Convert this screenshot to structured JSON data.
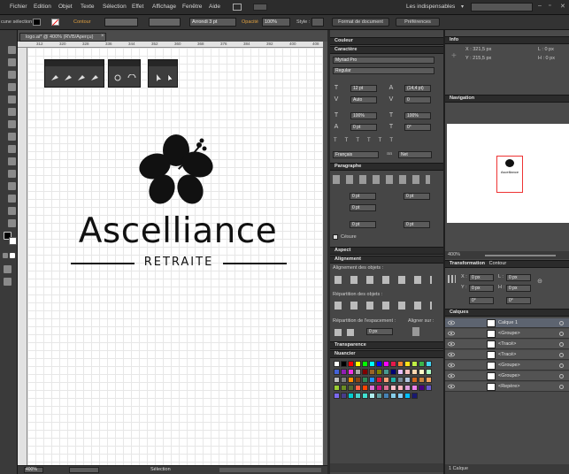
{
  "menu": [
    "Fichier",
    "Edition",
    "Objet",
    "Texte",
    "Sélection",
    "Effet",
    "Affichage",
    "Fenêtre",
    "Aide"
  ],
  "workspace": "Les indispensables",
  "control": {
    "selection_label": "cune sélection",
    "stroke_label": "Contour",
    "brush_value": "Arrondi 3 pt",
    "opacity_label": "Opacité",
    "opacity_value": "100%",
    "style_label": "Style :",
    "doc_format_button": "Format de document",
    "prefs_button": "Préférences"
  },
  "document": {
    "tab_title": "logo.ai* @ 400% (RVB/Aperçu)",
    "ruler_ticks": [
      "312",
      "320",
      "328",
      "336",
      "344",
      "352",
      "360",
      "368",
      "376",
      "384",
      "392",
      "400",
      "408"
    ],
    "zoom": "400%",
    "status": "Sélection"
  },
  "logo": {
    "name": "Ascelliance",
    "subtitle": "RETRAITE",
    "colors": {
      "ink": "#111111"
    }
  },
  "panels": {
    "color_tab": "Couleur",
    "character": {
      "title": "Caractère",
      "font": "Myriad Pro",
      "style": "Regular",
      "size": "12 pt",
      "leading": "(14,4 pt)",
      "kerning": "Auto",
      "tracking": "0",
      "hscale": "100%",
      "vscale": "100%",
      "baseline": "0 pt",
      "rotation": "0°",
      "lang": "Français",
      "aa": "Net"
    },
    "paragraph": {
      "title": "Paragraphe",
      "indent_left": "0 pt",
      "indent_right": "0 pt",
      "indent_first": "0 pt",
      "space_before": "0 pt",
      "space_after": "0 pt",
      "hyphen_label": "Césure"
    },
    "appearance_title": "Aspect",
    "align": {
      "title": "Alignement",
      "objects_label": "Alignement des objets :",
      "distrib_label": "Répartition des objets :",
      "spacing_label": "Répartition de l'espacement :",
      "align_to_label": "Aligner sur :",
      "spacing_value": "0 px"
    },
    "transparency_title": "Transparence",
    "swatches_title": "Nuancier",
    "info": {
      "title": "Info",
      "x": "X : 321,5 px",
      "y": "Y : 215,5 px",
      "w": "L : 0 px",
      "h": "H : 0 px"
    },
    "navigator": {
      "title": "Navigation",
      "zoom": "400%",
      "thumb_name": "Ascelliance"
    },
    "transform": {
      "title": "Transformation",
      "tab2": "Contour",
      "x": "0 px",
      "y": "0 px",
      "w": "0 px",
      "h": "0 px",
      "angle": "0°",
      "shear": "0°"
    },
    "layers": {
      "title": "Calques",
      "rows": [
        "Calque 1",
        "<Groupe>",
        "<Tracé>",
        "<Tracé>",
        "<Groupe>",
        "<Groupe>",
        "<Repère>"
      ],
      "footer": "1 Calque"
    }
  },
  "swatch_colors": [
    "#ffffff",
    "#000000",
    "#ff0000",
    "#ffff00",
    "#00ff00",
    "#00ffff",
    "#0000ff",
    "#ff00ff",
    "#e6194b",
    "#f58231",
    "#ffe119",
    "#bfef45",
    "#3cb44b",
    "#42d4f4",
    "#4363d8",
    "#911eb4",
    "#f032e6",
    "#a9a9a9",
    "#800000",
    "#9a6324",
    "#808000",
    "#469990",
    "#000075",
    "#e6beff",
    "#fabebe",
    "#ffd8b1",
    "#fffac8",
    "#aaffc3",
    "#c0c0c0",
    "#7f7f7f",
    "#ff8c00",
    "#8b4513",
    "#2e8b57",
    "#1e90ff",
    "#dc143c",
    "#ffa07a",
    "#20b2aa",
    "#778899",
    "#b0c4de",
    "#d2691e",
    "#cd853f",
    "#f4a460",
    "#9acd32",
    "#6b8e23",
    "#556b2f",
    "#ff6347",
    "#ff4500",
    "#da70d6",
    "#c71585",
    "#db7093",
    "#ffc0cb",
    "#ffb6c1",
    "#dda0dd",
    "#ee82ee",
    "#4b0082",
    "#6a5acd",
    "#7b68ee",
    "#483d8b",
    "#00ced1",
    "#48d1cc",
    "#40e0d0",
    "#afeeee",
    "#5f9ea0",
    "#4682b4",
    "#87ceeb",
    "#87cefa",
    "#00bfff",
    "#191970"
  ]
}
